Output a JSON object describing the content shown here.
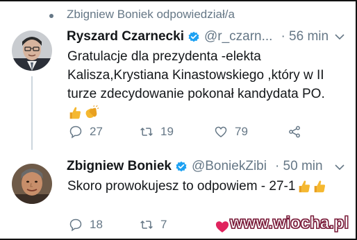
{
  "header": {
    "reply_context": "Zbigniew Boniek odpowiedział/a"
  },
  "tweets": [
    {
      "author_name": "Ryszard Czarnecki",
      "handle": "@r_czarn...",
      "time": "· 56 min",
      "text_lines": [
        "Gratulacje dla prezydenta -elekta",
        "Kalisza,Krystiana Kinastowskiego ,który w II",
        "turze zdecydowanie pokonał kandydata PO."
      ],
      "emoji": [
        "thumbs-up",
        "clapping-hands"
      ],
      "replies": "27",
      "retweets": "19",
      "likes": "79"
    },
    {
      "author_name": "Zbigniew Boniek",
      "handle": "@BoniekZibi",
      "time": "· 50 min",
      "text_lines": [
        "Skoro prowokujesz to odpowiem - 27-1"
      ],
      "emoji": [
        "thumbs-up",
        "thumbs-up"
      ],
      "replies": "18",
      "retweets": "7"
    }
  ],
  "watermark": {
    "text": "www.wiocha.pl"
  },
  "colors": {
    "secondary_text": "#657786",
    "verified": "#1da1f2",
    "emoji": "#f5b830",
    "watermark_heart": "#e0245e"
  }
}
